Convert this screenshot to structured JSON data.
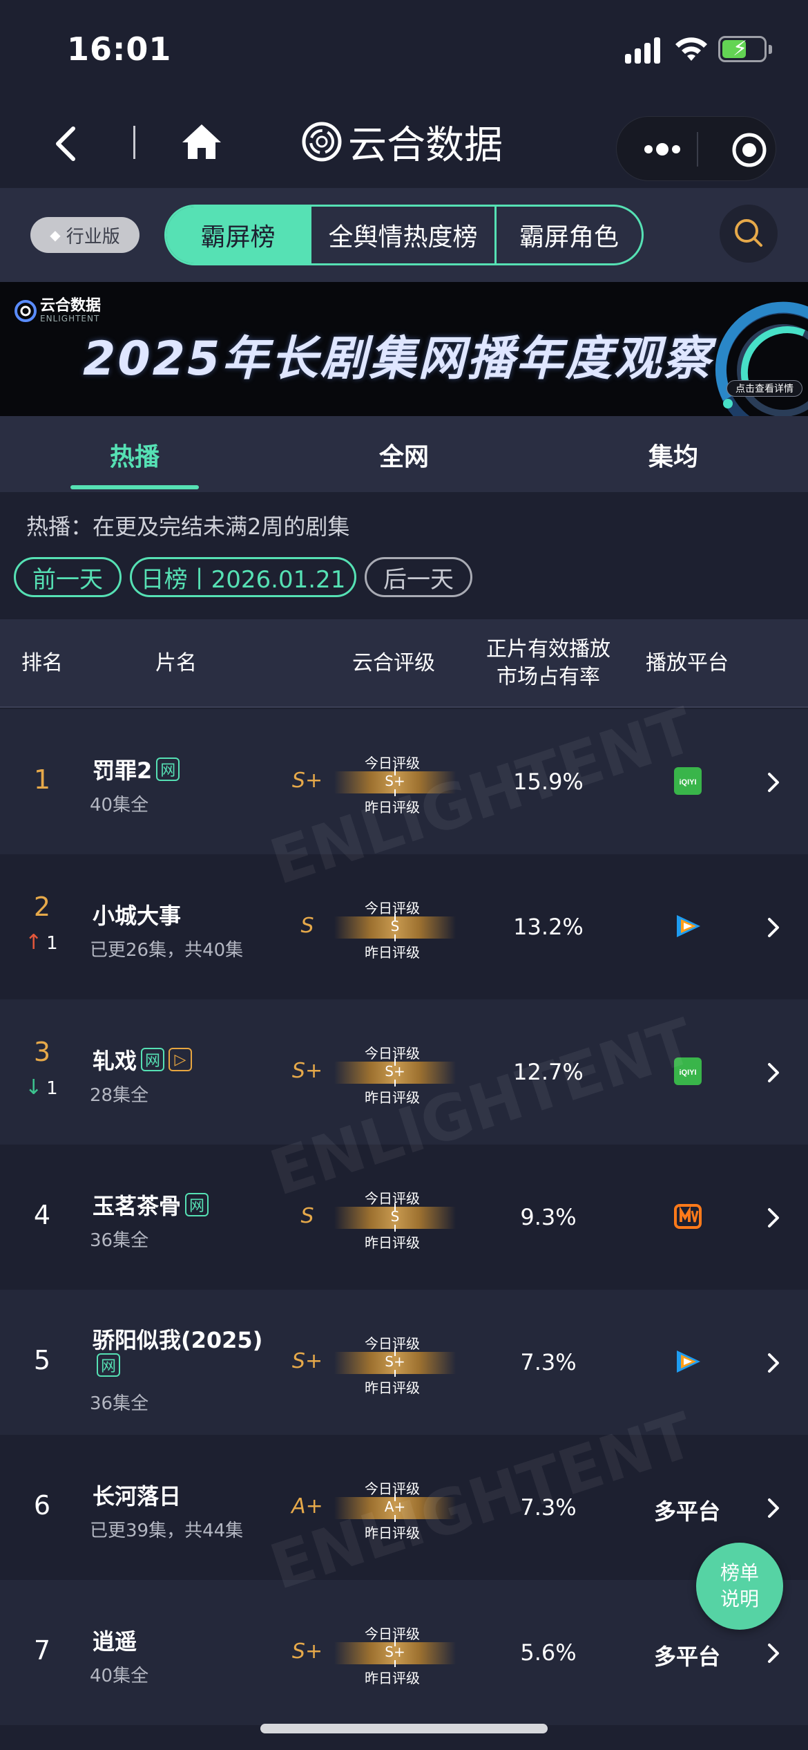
{
  "status_bar": {
    "time": "16:01"
  },
  "nav": {
    "title": "云合数据"
  },
  "top": {
    "edition": "行业版",
    "tabs": [
      "霸屏榜",
      "全舆情热度榜",
      "霸屏角色"
    ],
    "active_tab": "霸屏榜"
  },
  "banner": {
    "logo_text": "云合数据",
    "logo_sub": "ENLIGHTENT",
    "title": "2025年长剧集网播年度观察",
    "detail_button": "点击查看详情"
  },
  "sub_tabs": {
    "items": [
      "热播",
      "全网",
      "集均"
    ],
    "active": "热播"
  },
  "info": {
    "text": "热播：在更及完结未满2周的剧集"
  },
  "date_nav": {
    "prev": "前一天",
    "current": "日榜丨2026.01.21",
    "next": "后一天"
  },
  "table_header": {
    "rank": "排名",
    "title": "片名",
    "grade": "云合评级",
    "share_line1": "正片有效播放",
    "share_line2": "市场占有率",
    "platform": "播放平台"
  },
  "grade_caption": {
    "today": "今日评级",
    "yesterday": "昨日评级"
  },
  "rows": [
    {
      "rank": "1",
      "title": "罚罪2",
      "tags": [
        "网"
      ],
      "episodes": "40集全",
      "grade": "S+",
      "bar_grade": "S+",
      "share": "15.9%",
      "platform": "iqiyi",
      "platform_label": "",
      "change": ""
    },
    {
      "rank": "2",
      "title": "小城大事",
      "tags": [],
      "episodes": "已更26集，共40集",
      "grade": "S",
      "bar_grade": "S",
      "share": "13.2%",
      "platform": "tencent",
      "platform_label": "",
      "change": "1",
      "change_dir": "up"
    },
    {
      "rank": "3",
      "title": "轧戏",
      "tags": [
        "网",
        "▷"
      ],
      "episodes": "28集全",
      "grade": "S+",
      "bar_grade": "S+",
      "share": "12.7%",
      "platform": "iqiyi",
      "platform_label": "",
      "change": "1",
      "change_dir": "down"
    },
    {
      "rank": "4",
      "title": "玉茗茶骨",
      "tags": [
        "网"
      ],
      "episodes": "36集全",
      "grade": "S",
      "bar_grade": "S",
      "share": "9.3%",
      "platform": "mango",
      "platform_label": "",
      "change": ""
    },
    {
      "rank": "5",
      "title": "骄阳似我(2025)",
      "tags": [
        "网"
      ],
      "episodes": "36集全",
      "grade": "S+",
      "bar_grade": "S+",
      "share": "7.3%",
      "platform": "tencent",
      "platform_label": "",
      "change": ""
    },
    {
      "rank": "6",
      "title": "长河落日",
      "tags": [],
      "episodes": "已更39集，共44集",
      "grade": "A+",
      "bar_grade": "A+",
      "share": "7.3%",
      "platform": "multi",
      "platform_label": "多平台",
      "change": ""
    },
    {
      "rank": "7",
      "title": "逍遥",
      "tags": [],
      "episodes": "40集全",
      "grade": "S+",
      "bar_grade": "S+",
      "share": "5.6%",
      "platform": "multi",
      "platform_label": "多平台",
      "change": ""
    }
  ],
  "float_button": {
    "line1": "榜单",
    "line2": "说明"
  },
  "colors": {
    "accent": "#56e1b4",
    "rank_top": "#e6a94a",
    "up": "#e4573b",
    "down": "#3cc48f",
    "background": "#1d2030"
  },
  "icons": [
    "back-icon",
    "home-icon",
    "more-icon",
    "target-icon",
    "search-icon",
    "diamond-icon",
    "chevron-right-icon",
    "iqiyi-logo",
    "tencent-video-logo",
    "mango-tv-logo"
  ]
}
